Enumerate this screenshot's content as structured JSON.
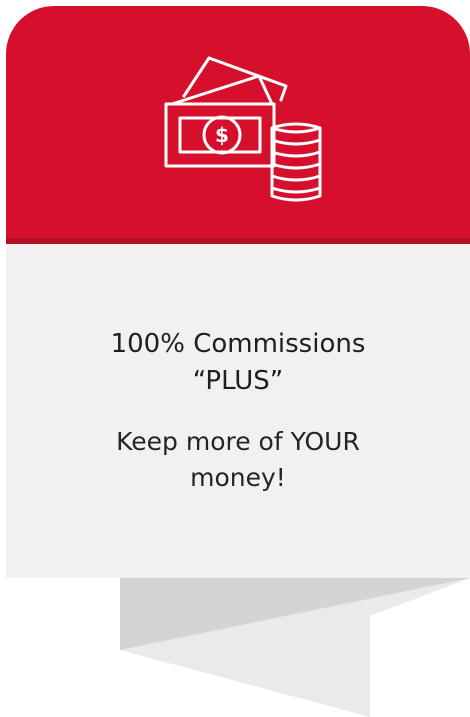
{
  "card": {
    "title_line1": "100% Commissions",
    "title_line2": "“PLUS”",
    "subtitle_line1": "Keep more of YOUR",
    "subtitle_line2": "money!"
  },
  "icon": {
    "name": "money-cash-coins-icon",
    "currency_symbol": "$"
  },
  "colors": {
    "header": "#d6102c",
    "header_line": "#b20d25",
    "body": "#f1f1f1",
    "text": "#1f1f1f",
    "ribbon_light": "#eaeaea",
    "ribbon_dark": "#d4d4d4"
  }
}
